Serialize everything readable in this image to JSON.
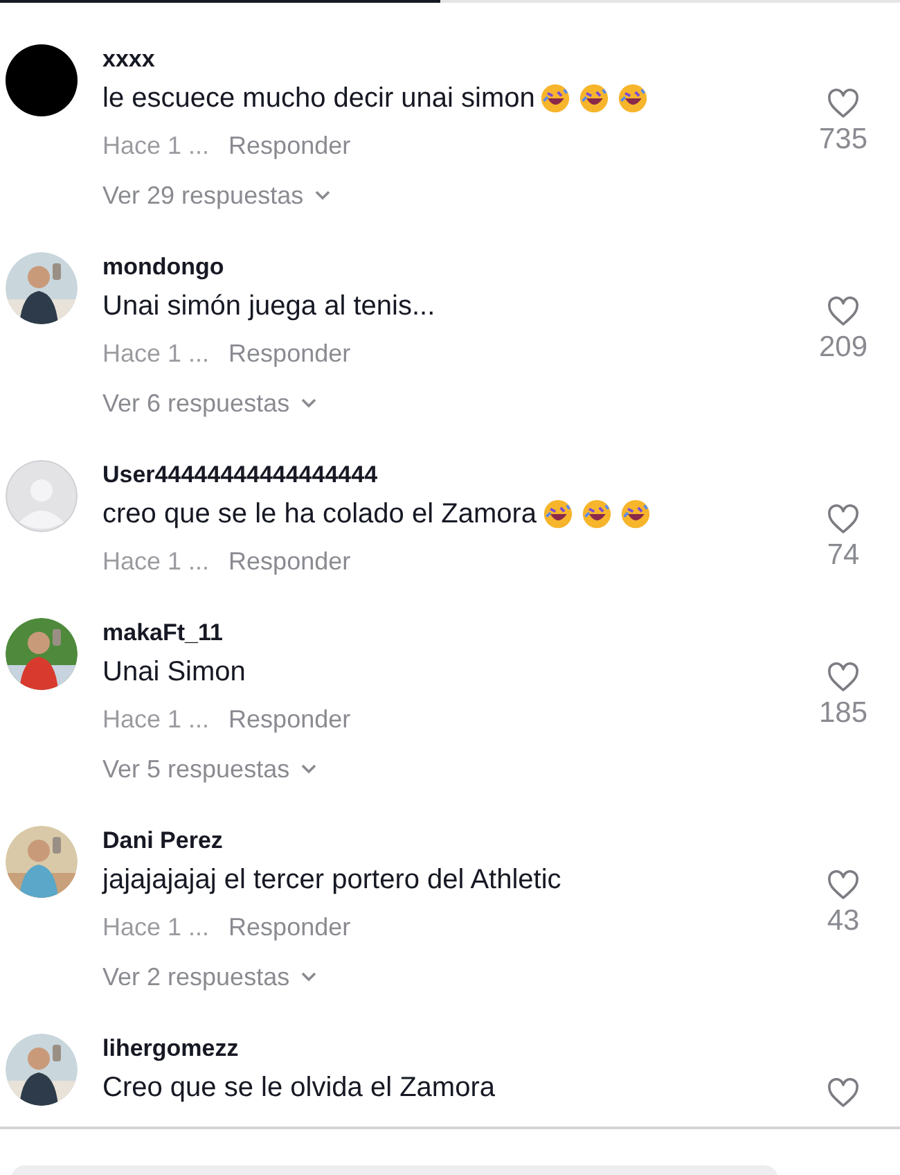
{
  "tabs": [
    {
      "selected": true
    },
    {
      "selected": false
    }
  ],
  "comments": [
    {
      "avatar": {
        "kind": "black"
      },
      "username": "xxxx",
      "text": "le escuece mucho decir unai simon",
      "emojis": [
        {
          "kind": "laugh"
        },
        {
          "kind": "laugh"
        },
        {
          "kind": "laugh"
        }
      ],
      "time": "Hace 1 ...",
      "reply": "Responder",
      "likes": "735",
      "replies": "Ver 29 respuestas"
    },
    {
      "username": "mondongo",
      "text": "Unai simón juega al tenis...",
      "time": "Hace 1 ...",
      "reply": "Responder",
      "likes": "209",
      "replies": "Ver 6 respuestas"
    },
    {
      "avatar": {
        "kind": "default"
      },
      "username": "User44444444444444444",
      "text": "creo que se le ha colado el Zamora",
      "emojis": [
        {
          "kind": "laugh"
        },
        {
          "kind": "laugh"
        },
        {
          "kind": "laugh"
        }
      ],
      "time": "Hace 1 ...",
      "reply": "Responder",
      "likes": "74"
    },
    {
      "username": "makaFt_11",
      "text": "Unai Simon",
      "time": "Hace 1 ...",
      "reply": "Responder",
      "likes": "185",
      "replies": "Ver 5 respuestas"
    },
    {
      "username": "Dani Perez",
      "text": "jajajajajaj el tercer portero del Athletic",
      "time": "Hace 1 ...",
      "reply": "Responder",
      "likes": "43",
      "replies": "Ver 2 respuestas"
    },
    {
      "username": "lihergomezz",
      "text": "Creo que se le olvida el Zamora"
    }
  ]
}
